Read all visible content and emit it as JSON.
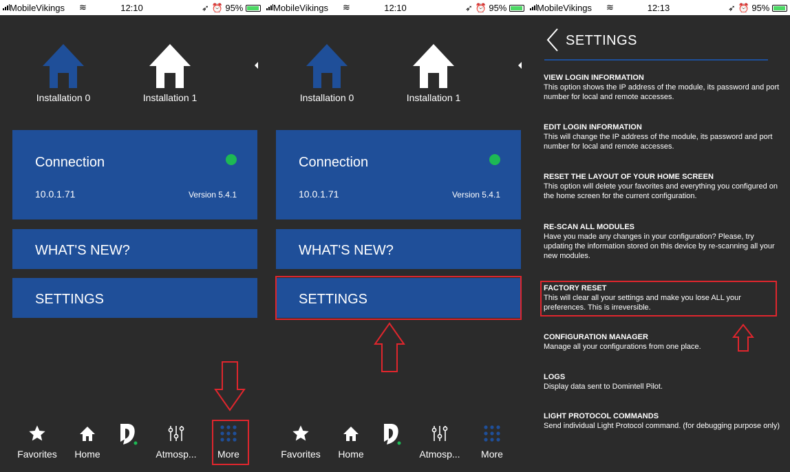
{
  "status": [
    {
      "carrier": "MobileVikings",
      "time": "12:10",
      "battery": "95%"
    },
    {
      "carrier": "MobileVikings",
      "time": "12:10",
      "battery": "95%"
    },
    {
      "carrier": "MobileVikings",
      "time": "12:13",
      "battery": "95%"
    }
  ],
  "installations": [
    "Installation 0",
    "Installation 1"
  ],
  "connection": {
    "title": "Connection",
    "ip": "10.0.1.71",
    "version": "Version 5.4.1"
  },
  "whats_new": "WHAT'S NEW?",
  "settings_label": "SETTINGS",
  "tabs": [
    "Favorites",
    "Home",
    "",
    "Atmosp...",
    "More"
  ],
  "settings_screen": {
    "title": "SETTINGS",
    "options": [
      {
        "heading": "VIEW LOGIN INFORMATION",
        "desc": "This option shows the IP address of the module, its password and port number for local and remote accesses."
      },
      {
        "heading": "EDIT LOGIN INFORMATION",
        "desc": "This will change the IP address of the module, its password and port number for local and remote accesses."
      },
      {
        "heading": "RESET THE LAYOUT OF YOUR HOME SCREEN",
        "desc": "This option will delete your favorites and everything you configured on the home screen for the current configuration."
      },
      {
        "heading": "RE-SCAN ALL MODULES",
        "desc": "Have you made any changes in your configuration? Please, try updating the information stored on this device by re-scanning all your new modules."
      },
      {
        "heading": "FACTORY RESET",
        "desc": "This will clear all your settings and make you lose ALL your preferences. This is irreversible."
      },
      {
        "heading": "CONFIGURATION MANAGER",
        "desc": "Manage all your configurations from one place."
      },
      {
        "heading": "LOGS",
        "desc": "Display data sent to Domintell Pilot."
      },
      {
        "heading": "LIGHT PROTOCOL COMMANDS",
        "desc": "Send individual Light Protocol command. (for debugging purpose only)"
      }
    ]
  },
  "colors": {
    "card": "#1f4f99",
    "background": "#2b2b2b",
    "status_dot": "#1db954",
    "annotation": "#e0262d"
  }
}
